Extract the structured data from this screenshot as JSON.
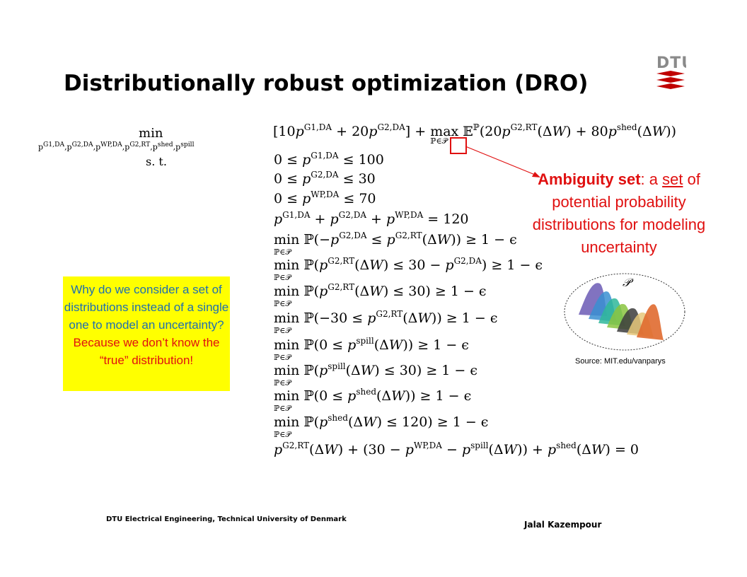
{
  "title": "Distributionally robust optimization (DRO)",
  "logo": {
    "text": "DTU",
    "color": "#c00000"
  },
  "formulation": {
    "min_op": "min",
    "min_vars": "p^{G1,DA}, p^{G2,DA}, p^{WP,DA}, p^{G2,RT}, p^{shed}, p^{spill}",
    "st": "s. t.",
    "objective": "[10p^{G1,DA} + 20p^{G2,DA}] + max_{ℙ∈𝒫} 𝔼^ℙ(20p^{G2,RT}(ΔW) + 80p^{shed}(ΔW))",
    "constraints": [
      "0 ≤ p^{G1,DA} ≤ 100",
      "0 ≤ p^{G2,DA} ≤ 30",
      "0 ≤ p^{WP,DA} ≤ 70",
      "p^{G1,DA} + p^{G2,DA} + p^{WP,DA} = 120",
      "min_{ℙ∈𝒫} ℙ(−p^{G2,DA} ≤ p^{G2,RT}(ΔW)) ≥ 1 − ϵ",
      "min_{ℙ∈𝒫} ℙ(p^{G2,RT}(ΔW) ≤ 30 − p^{G2,DA}) ≥ 1 − ϵ",
      "min_{ℙ∈𝒫} ℙ(p^{G2,RT}(ΔW) ≤ 30) ≥ 1 − ϵ",
      "min_{ℙ∈𝒫} ℙ(−30 ≤ p^{G2,RT}(ΔW)) ≥ 1 − ϵ",
      "min_{ℙ∈𝒫} ℙ(0 ≤ p^{spill}(ΔW)) ≥ 1 − ϵ",
      "min_{ℙ∈𝒫} ℙ(p^{spill}(ΔW) ≤ 30) ≥ 1 − ϵ",
      "min_{ℙ∈𝒫} ℙ(0 ≤ p^{shed}(ΔW)) ≥ 1 − ϵ",
      "min_{ℙ∈𝒫} ℙ(p^{shed}(ΔW) ≤ 120) ≥ 1 − ϵ",
      "p^{G2,RT}(ΔW) + (30 − p^{WP,DA} − p^{spill}(ΔW)) + p^{shed}(ΔW) = 0"
    ]
  },
  "ambiguity": {
    "bold": "Ambiguity set",
    "sep": ": a ",
    "underlined": "set",
    "rest": " of potential probability distributions for modeling uncertainty",
    "color": "#e01010"
  },
  "question_box": {
    "question": "Why do we consider a set of distributions instead of a single one to model an uncertainty?",
    "answer": "Because we don’t know the “true” distribution!",
    "bg": "#ffff00",
    "question_color": "#1f6fb0",
    "answer_color": "#e01010"
  },
  "dist_image": {
    "label": "𝒫"
  },
  "source": "Source: MIT.edu/vanparys",
  "footer": {
    "left": "DTU Electrical Engineering, Technical University of Denmark",
    "right": "Jalal Kazempour"
  }
}
